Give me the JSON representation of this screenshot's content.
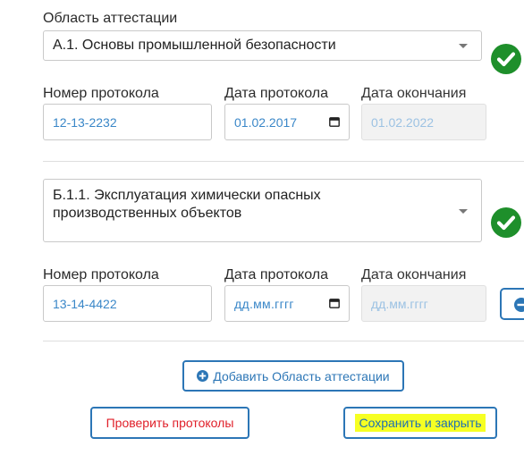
{
  "block1": {
    "area_label": "Область аттестации",
    "area_value": "А.1. Основы промышленной безопасности",
    "protocol_number_label": "Номер протокола",
    "protocol_number_value": "12-13-2232",
    "protocol_date_label": "Дата протокола",
    "protocol_date_value": "01.02.2017",
    "end_date_label": "Дата окончания",
    "end_date_value": "01.02.2022"
  },
  "block2": {
    "area_value": "Б.1.1. Эксплуатация химически опасных производственных объектов",
    "protocol_number_label": "Номер протокола",
    "protocol_number_value": "13-14-4422",
    "protocol_date_label": "Дата протокола",
    "protocol_date_placeholder": "дд.мм.гггг",
    "end_date_label": "Дата окончания",
    "end_date_placeholder": "дд.мм.гггг"
  },
  "actions": {
    "add_area_label": "Добавить Область аттестации",
    "check_protocols_label": "Проверить протоколы",
    "save_close_label": "Сохранить и закрыть"
  },
  "colors": {
    "accent": "#2c76b6",
    "success": "#1e8f2b",
    "danger": "#e0202a",
    "highlight": "#f6ff23"
  },
  "icons": {
    "valid": "check-circle-icon",
    "dropdown": "chevron-down-icon",
    "calendar": "calendar-icon",
    "add": "plus-circle-icon",
    "remove": "minus-circle-icon"
  }
}
